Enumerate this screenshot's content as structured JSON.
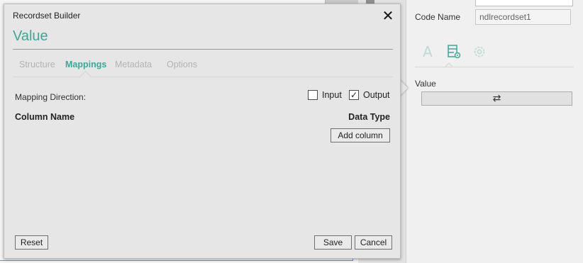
{
  "dialog": {
    "title": "Recordset Builder",
    "heading": "Value",
    "tabs": [
      {
        "label": "Structure",
        "active": false
      },
      {
        "label": "Mappings",
        "active": true
      },
      {
        "label": "Metadata",
        "active": false
      },
      {
        "label": "Options",
        "active": false
      }
    ],
    "mapping_direction_label": "Mapping Direction:",
    "input_option": {
      "label": "Input",
      "checked": false
    },
    "output_option": {
      "label": "Output",
      "checked": true
    },
    "column_name_header": "Column Name",
    "data_type_header": "Data Type",
    "add_column_label": "Add column",
    "reset_label": "Reset",
    "save_label": "Save",
    "cancel_label": "Cancel",
    "close_icon": "close-icon",
    "accent_color": "#3aa89a"
  },
  "properties": {
    "code_name_label": "Code Name",
    "code_name_value": "ndlrecordset1",
    "tabs": [
      {
        "icon": "text-icon",
        "glyph": "A"
      },
      {
        "icon": "recordset-settings-icon"
      },
      {
        "icon": "gear-icon"
      }
    ],
    "value_label": "Value",
    "value_button_glyph": "⇄",
    "value_button_icon": "swap-arrows-icon"
  }
}
